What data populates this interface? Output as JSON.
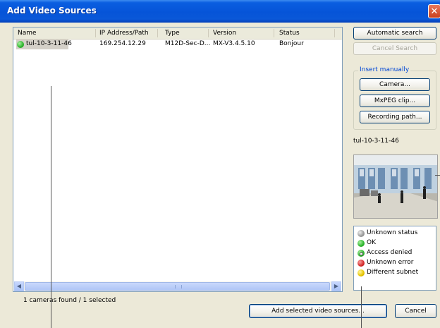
{
  "window": {
    "title": "Add Video Sources",
    "close_glyph": "✕"
  },
  "list": {
    "columns": [
      "Name",
      "IP Address/Path",
      "Type",
      "Version",
      "Status"
    ],
    "rows": [
      {
        "name": "tul-10-3-11-46",
        "ip": "169.254.12.29",
        "type": "M12D-Sec-D...",
        "version": "MX-V3.4.5.10",
        "status": "Bonjour",
        "status_icon": "ok-status-icon"
      }
    ],
    "scroll_left": "◀",
    "scroll_right": "▶"
  },
  "status_text": "1 cameras found / 1 selected",
  "buttons": {
    "automatic_search": "Automatic search",
    "cancel_search": "Cancel Search",
    "camera": "Camera...",
    "mxpeg_clip": "MxPEG clip...",
    "recording_path": "Recording path...",
    "add_selected": "Add selected video sources...",
    "cancel": "Cancel"
  },
  "insert_group": {
    "label": "Insert manually"
  },
  "selected_camera": "tul-10-3-11-46",
  "legend": [
    {
      "label": "Unknown status",
      "color": "#9a9a9a"
    },
    {
      "label": "OK",
      "color": "#2db52d"
    },
    {
      "label": "Access denied",
      "color": "#2db52d"
    },
    {
      "label": "Unknown error",
      "color": "#d42a2a"
    },
    {
      "label": "Different subnet",
      "color": "#e6c400"
    }
  ]
}
